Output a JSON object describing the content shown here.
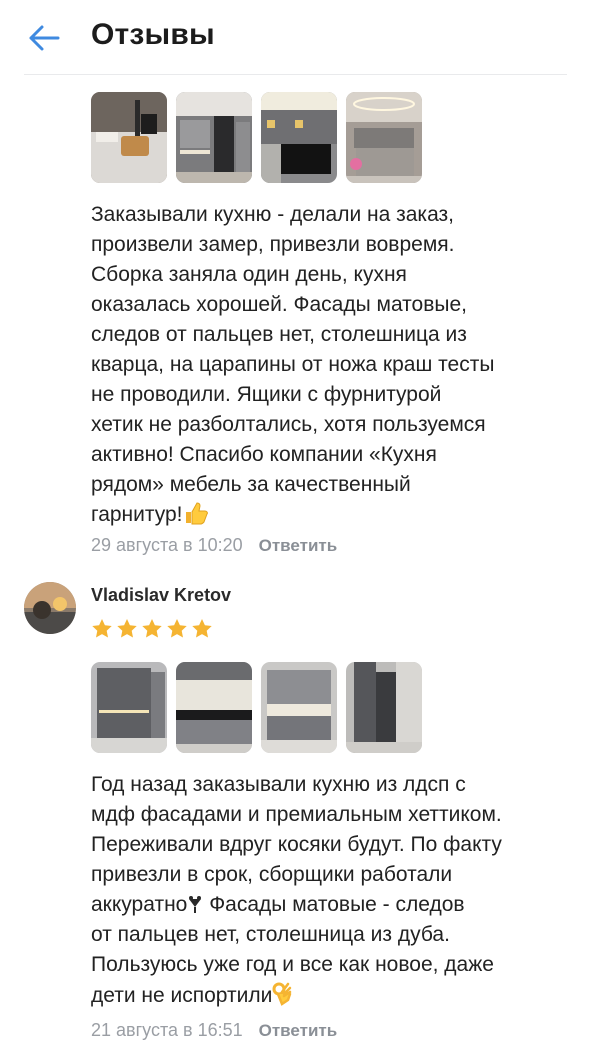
{
  "header": {
    "title": "Отзывы",
    "back_icon": "arrow-left-icon",
    "accent": "#3f8ae0"
  },
  "reviews": [
    {
      "photos": [
        "kitchen-photo",
        "kitchen-photo",
        "kitchen-photo",
        "kitchen-photo"
      ],
      "text": "Заказывали кухню - делали на заказ,\nпроизвели замер, привезли вовремя.\nСборка заняла один день, кухня\nоказалась хорошей. Фасады матовые,\nследов от пальцев нет, столешница из\nкварца, на царапины от ножа краш тесты\nне проводили. Ящики с фурнитурой\nхетик не разболтались, хотя пользуемся\nактивно! Спасибо компании «Кухня\nрядом» мебель за качественный\nгарнитур!",
      "end_emoji": "thumbs-up-icon",
      "date": "29 августа в 10:20",
      "reply_label": "Ответить"
    },
    {
      "author": "Vladislav Kretov",
      "avatar_icon": "avatar",
      "rating": 5,
      "rating_max": 5,
      "star_color": "#f5b432",
      "photos": [
        "kitchen-photo",
        "kitchen-photo",
        "kitchen-photo",
        "kitchen-photo"
      ],
      "text_lines": [
        "Год назад заказывали кухню из лдсп с",
        "мдф фасадами и премиальным хеттиком.",
        "Переживали вдруг косяки будут. По факту",
        "привезли в срок, сборщики работали",
        "аккуратно",
        " Фасады матовые - следов",
        "от пальцев нет, столешница из дуба.",
        "Пользуюсь уже год и все как новое, даже",
        "дети не испортили"
      ],
      "inline_emoji": "sparkle-icon",
      "end_emoji": "ok-hand-icon",
      "date": "21 августа в 16:51",
      "reply_label": "Ответить"
    }
  ]
}
